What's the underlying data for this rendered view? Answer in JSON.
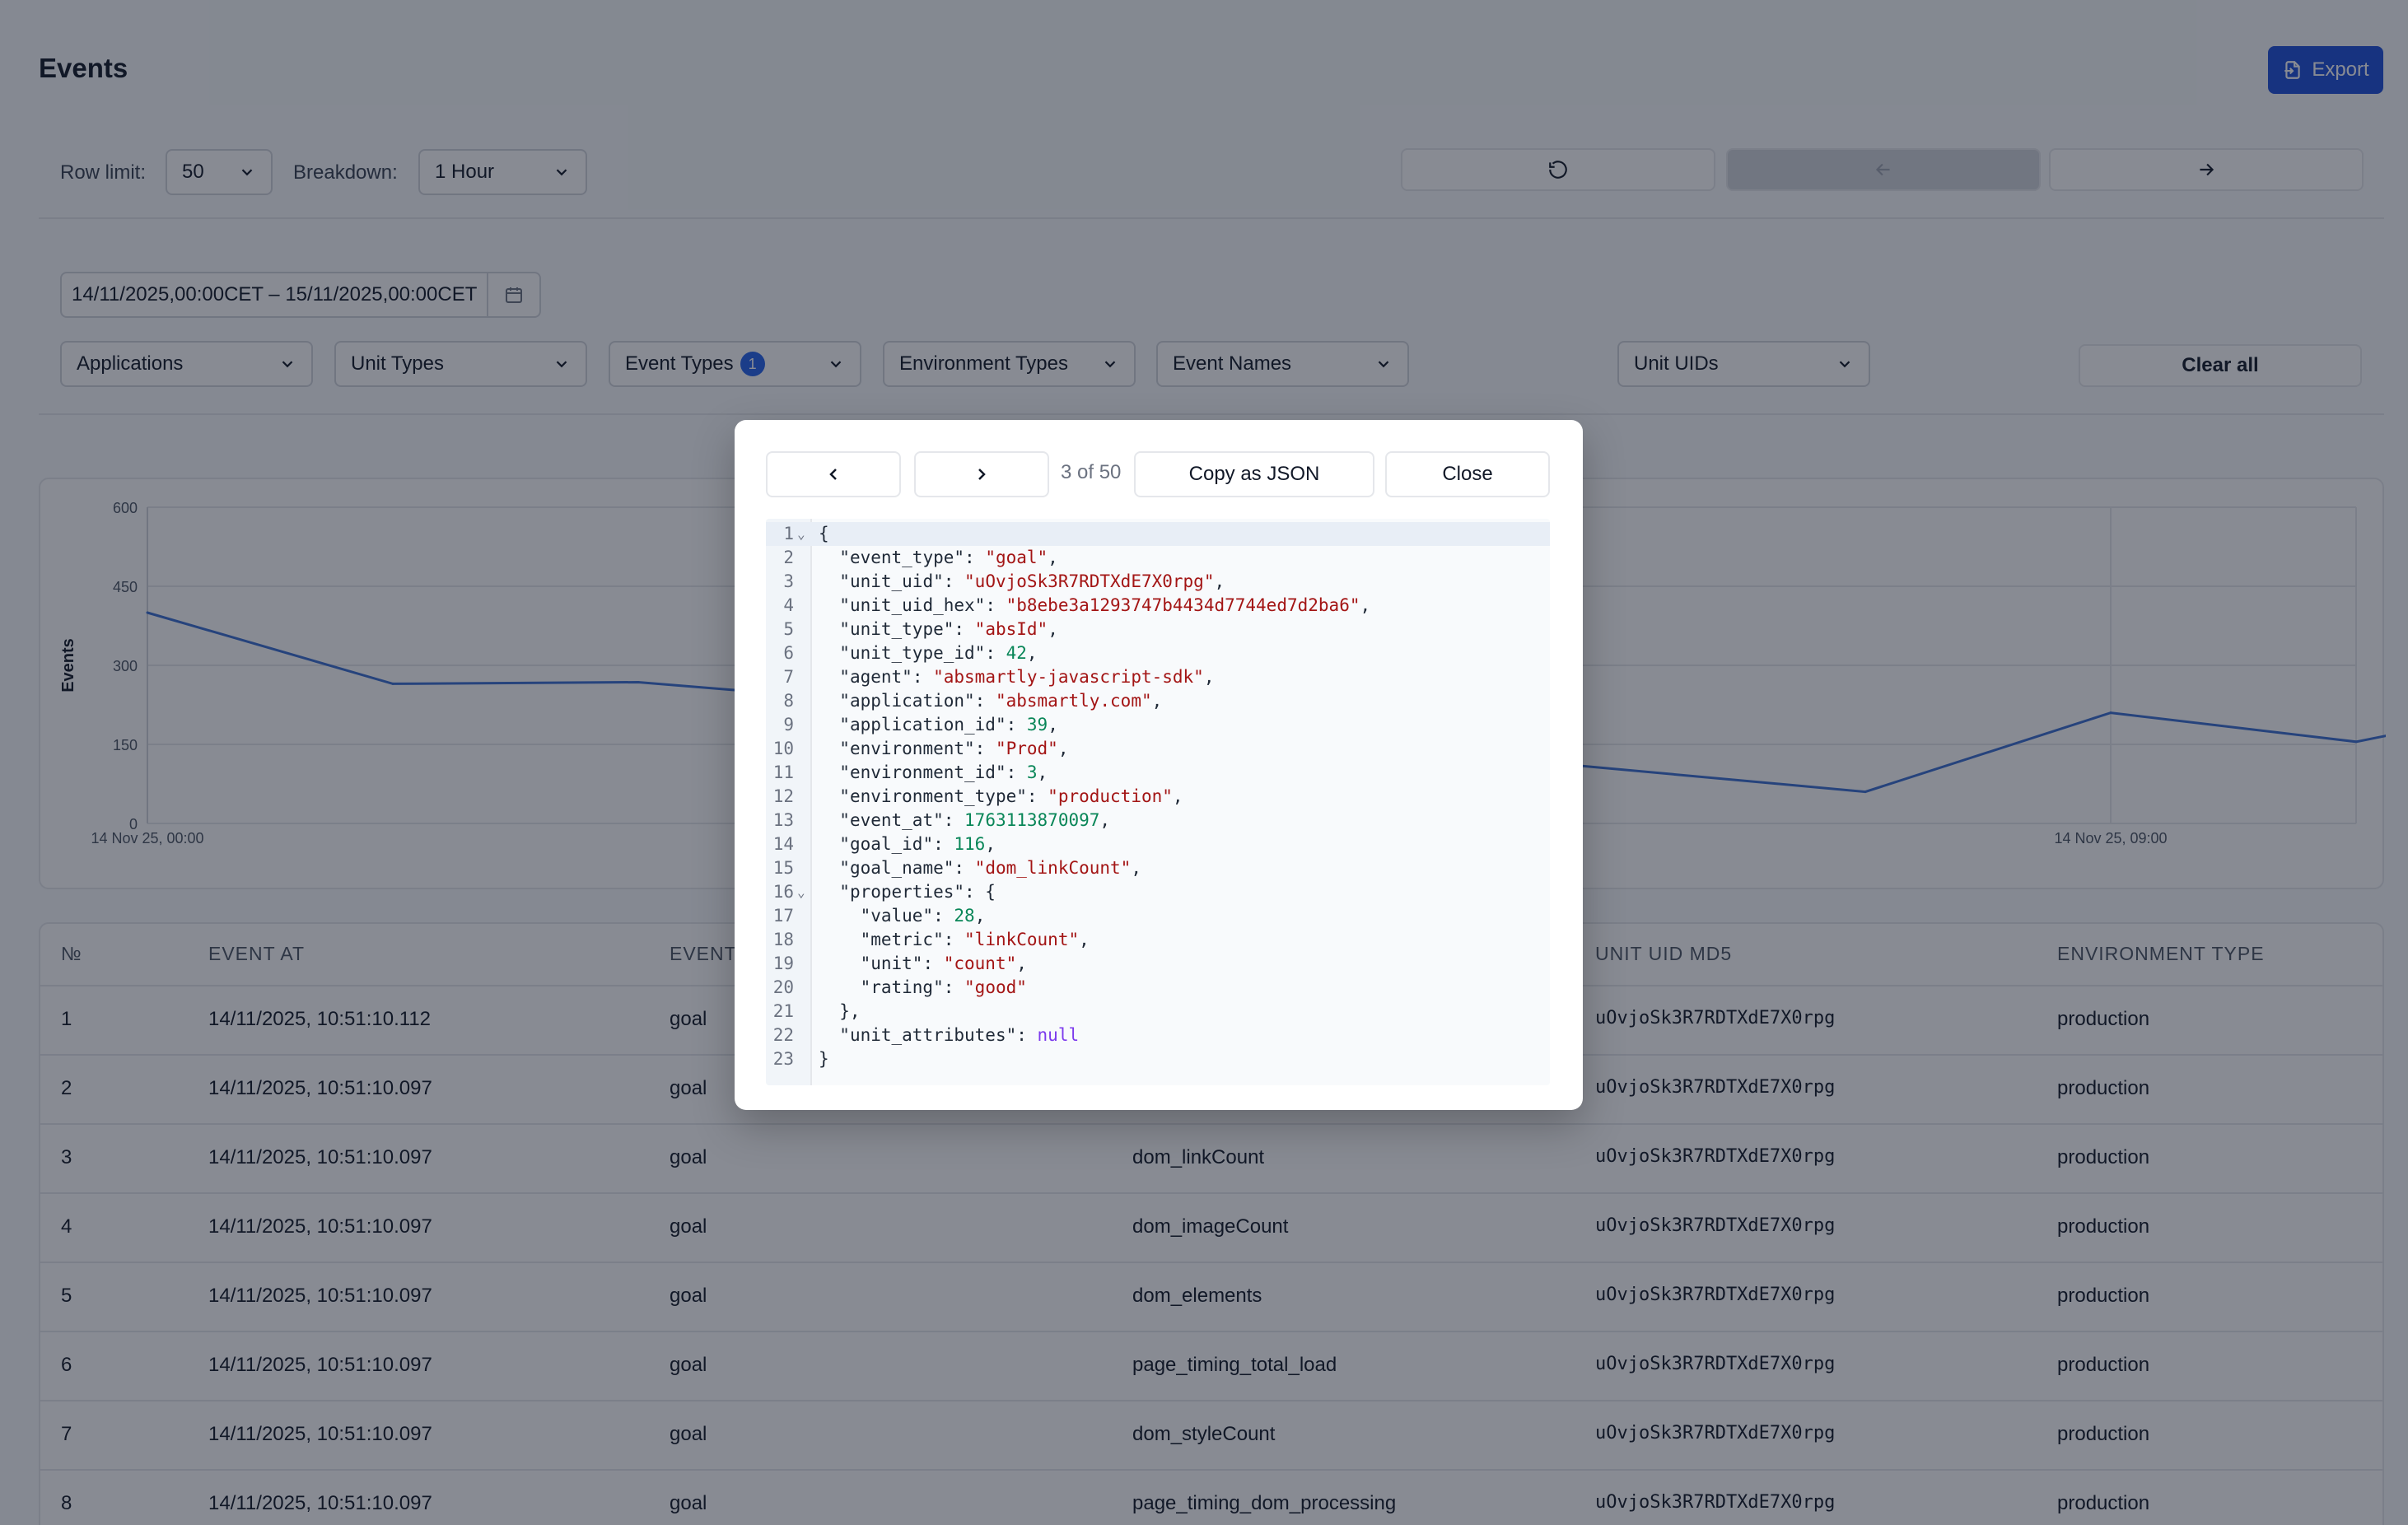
{
  "page": {
    "title": "Events",
    "export_label": "Export"
  },
  "filters": {
    "row_limit_label": "Row limit:",
    "row_limit_value": "50",
    "breakdown_label": "Breakdown:",
    "breakdown_value": "1 Hour",
    "date_range": "14/11/2025,00:00CET  –  15/11/2025,00:00CET",
    "applications": "Applications",
    "unit_types": "Unit Types",
    "event_types": "Event Types",
    "event_types_count": "1",
    "environment_types": "Environment Types",
    "event_names": "Event Names",
    "unit_uids": "Unit UIDs",
    "clear_all": "Clear all"
  },
  "chart_data": {
    "type": "line",
    "ylabel": "Events",
    "ylim": [
      0,
      600
    ],
    "yticks": [
      "0",
      "150",
      "300",
      "450",
      "600"
    ],
    "xtick_labels": [
      "14 Nov 25, 00:00",
      "14 Nov 25, 09:00"
    ],
    "series": [
      {
        "color": "#3b6fd1",
        "x": [
          0,
          1,
          2,
          3,
          7,
          8,
          9,
          10
        ],
        "y": [
          400,
          265,
          268,
          230,
          60,
          210,
          155,
          248
        ]
      }
    ]
  },
  "table": {
    "headers": [
      "№",
      "EVENT AT",
      "EVENT",
      "",
      "UNIT UID MD5",
      "ENVIRONMENT TYPE"
    ],
    "rows": [
      {
        "n": "1",
        "at": "14/11/2025, 10:51:10.112",
        "type": "goal",
        "name": "",
        "uid": "uOvjoSk3R7RDTXdE7X0rpg",
        "env": "production"
      },
      {
        "n": "2",
        "at": "14/11/2025, 10:51:10.097",
        "type": "goal",
        "name": "",
        "uid": "uOvjoSk3R7RDTXdE7X0rpg",
        "env": "production"
      },
      {
        "n": "3",
        "at": "14/11/2025, 10:51:10.097",
        "type": "goal",
        "name": "dom_linkCount",
        "uid": "uOvjoSk3R7RDTXdE7X0rpg",
        "env": "production"
      },
      {
        "n": "4",
        "at": "14/11/2025, 10:51:10.097",
        "type": "goal",
        "name": "dom_imageCount",
        "uid": "uOvjoSk3R7RDTXdE7X0rpg",
        "env": "production"
      },
      {
        "n": "5",
        "at": "14/11/2025, 10:51:10.097",
        "type": "goal",
        "name": "dom_elements",
        "uid": "uOvjoSk3R7RDTXdE7X0rpg",
        "env": "production"
      },
      {
        "n": "6",
        "at": "14/11/2025, 10:51:10.097",
        "type": "goal",
        "name": "page_timing_total_load",
        "uid": "uOvjoSk3R7RDTXdE7X0rpg",
        "env": "production"
      },
      {
        "n": "7",
        "at": "14/11/2025, 10:51:10.097",
        "type": "goal",
        "name": "dom_styleCount",
        "uid": "uOvjoSk3R7RDTXdE7X0rpg",
        "env": "production"
      },
      {
        "n": "8",
        "at": "14/11/2025, 10:51:10.097",
        "type": "goal",
        "name": "page_timing_dom_processing",
        "uid": "uOvjoSk3R7RDTXdE7X0rpg",
        "env": "production"
      }
    ]
  },
  "modal": {
    "counter": "3 of 50",
    "copy_label": "Copy as JSON",
    "close_label": "Close",
    "code_lines": [
      "{",
      "  \"event_type\": \"goal\",",
      "  \"unit_uid\": \"uOvjoSk3R7RDTXdE7X0rpg\",",
      "  \"unit_uid_hex\": \"b8ebe3a1293747b4434d7744ed7d2ba6\",",
      "  \"unit_type\": \"absId\",",
      "  \"unit_type_id\": 42,",
      "  \"agent\": \"absmartly-javascript-sdk\",",
      "  \"application\": \"absmartly.com\",",
      "  \"application_id\": 39,",
      "  \"environment\": \"Prod\",",
      "  \"environment_id\": 3,",
      "  \"environment_type\": \"production\",",
      "  \"event_at\": 1763113870097,",
      "  \"goal_id\": 116,",
      "  \"goal_name\": \"dom_linkCount\",",
      "  \"properties\": {",
      "    \"value\": 28,",
      "    \"metric\": \"linkCount\",",
      "    \"unit\": \"count\",",
      "    \"rating\": \"good\"",
      "  },",
      "  \"unit_attributes\": null",
      "}"
    ]
  }
}
